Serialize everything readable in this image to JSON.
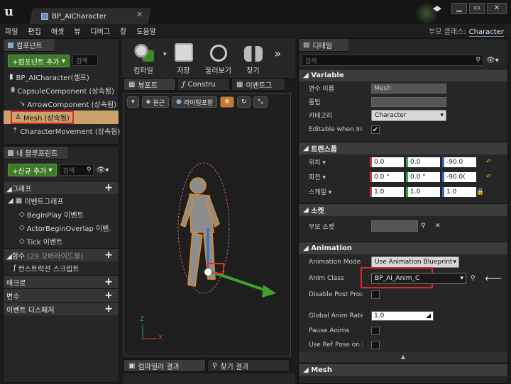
{
  "window": {
    "title": "BP_AICharacter",
    "parent_class_label": "부모 클래스:",
    "parent_class_value": "Character"
  },
  "menu": [
    "파일",
    "편집",
    "애셋",
    "뷰",
    "디버그",
    "창",
    "도움말"
  ],
  "components_panel": {
    "tab": "컴포넌트",
    "add_button": "+컴포넌트 추가",
    "search_placeholder": "검색",
    "items": [
      {
        "label": "BP_AICharacter(셀프)"
      },
      {
        "label": "CapsuleComponent (상속됨)"
      },
      {
        "label": "ArrowComponent (상속됨)"
      },
      {
        "label": "Mesh (상속됨)",
        "selected": true
      },
      {
        "label": "CharacterMovement (상속됨)"
      }
    ]
  },
  "blueprint_panel": {
    "tab": "내 블루프린트",
    "add_button": "+신규 추가",
    "search_placeholder": "검색",
    "sections": {
      "graph": "그래프",
      "event_graph": "이벤트그래프",
      "events": [
        "BeginPlay 이벤트",
        "ActorBeginOverlap 이벤.",
        "Tick 이벤트"
      ],
      "functions": "함수",
      "functions_count": "(29 오버라이드블)",
      "construction": "컨스트럭션 스크립트",
      "macros": "매크로",
      "variables": "변수",
      "dispatchers": "이벤트 디스패처"
    }
  },
  "toolbar": {
    "compile": "컴파일",
    "save": "저장",
    "browse": "둘러보기",
    "find": "찾기"
  },
  "viewport": {
    "tabs": [
      "뷰포트",
      "Constru",
      "이벤트그"
    ],
    "perspective": "원근",
    "lit": "라이팅포함",
    "axis_x": "X",
    "axis_z": "Z",
    "bottom_tabs": [
      "컴파일러 결과",
      "찾기 결과"
    ]
  },
  "details": {
    "tab": "디테일",
    "search_placeholder": "검색",
    "variable": {
      "header": "Variable",
      "name_label": "변수 이름",
      "name_value": "Mesh",
      "tooltip_label": "툴팁",
      "category_label": "카테고리",
      "category_value": "Character",
      "editable_label": "Editable when Inher"
    },
    "transform": {
      "header": "트랜스폼",
      "location_label": "위치",
      "location": [
        "0.0",
        "0.0",
        "-90.0"
      ],
      "rotation_label": "회전",
      "rotation": [
        "0.0 °",
        "0.0 °",
        "-90.0("
      ],
      "scale_label": "스케일",
      "scale": [
        "1.0",
        "1.0",
        "1.0"
      ]
    },
    "sockets": {
      "header": "소켓",
      "parent_socket_label": "부모 소켓"
    },
    "animation": {
      "header": "Animation",
      "mode_label": "Animation Mode",
      "mode_value": "Use Animation Blueprint",
      "anim_class_label": "Anim Class",
      "anim_class_value": "BP_AI_Anim_C",
      "disable_post_label": "Disable Post Proce:",
      "rate_label": "Global Anim Rate S",
      "rate_value": "1.0",
      "pause_label": "Pause Anims",
      "ref_pose_label": "Use Ref Pose on Ini"
    },
    "mesh": {
      "header": "Mesh"
    }
  },
  "colors": {
    "accent_green": "#3e7a28",
    "highlight_red": "#e3262b",
    "selected_row": "#c9a36b"
  }
}
